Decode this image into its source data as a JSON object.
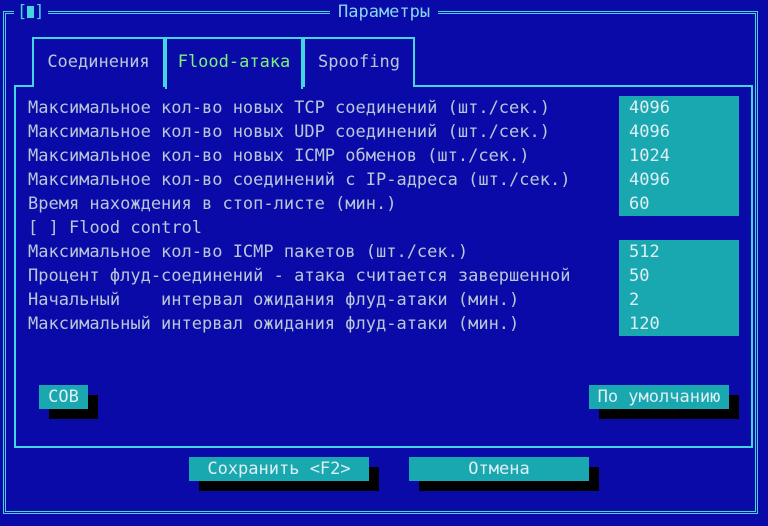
{
  "window": {
    "title": "Параметры",
    "close_glyph": "[▮]"
  },
  "tabs": [
    {
      "label": "Соединения",
      "active": false
    },
    {
      "label": "Flood-атака",
      "active": true
    },
    {
      "label": "Spoofing",
      "active": false
    }
  ],
  "settings": [
    {
      "label": "Максимальное кол-во новых TCP соединений (шт./сек.)",
      "value": "4096"
    },
    {
      "label": "Максимальное кол-во новых UDP соединений (шт./сек.)",
      "value": "4096"
    },
    {
      "label": "Максимальное кол-во новых ICMP обменов (шт./сек.)",
      "value": "1024"
    },
    {
      "label": "Максимальное кол-во соединений с IP-адреса (шт./сек.)",
      "value": "4096"
    },
    {
      "label": "Время нахождения в стоп-листе (мин.)",
      "value": "60"
    },
    {
      "label": "Максимальное кол-во ICMP пакетов (шт./сек.)",
      "value": "512"
    },
    {
      "label": "Процент флуд-соединений - атака считается завершенной",
      "value": "50"
    },
    {
      "label": "Начальный    интервал ожидания флуд-атаки (мин.)",
      "value": "2"
    },
    {
      "label": "Максимальный интервал ожидания флуд-атаки (мин.)",
      "value": "120"
    }
  ],
  "flood_control": {
    "box": "[ ]",
    "label": "Flood control",
    "checked": false
  },
  "buttons": {
    "sov": "СОВ",
    "defaults": "По умолчанию",
    "save": "Сохранить <F2>",
    "cancel": "Отмена"
  },
  "colors": {
    "background": "#0a0aa8",
    "frame": "#44d6e0",
    "field": "#1aa8b0",
    "active_tab_text": "#7df07d",
    "title_text": "#88d6f0"
  }
}
